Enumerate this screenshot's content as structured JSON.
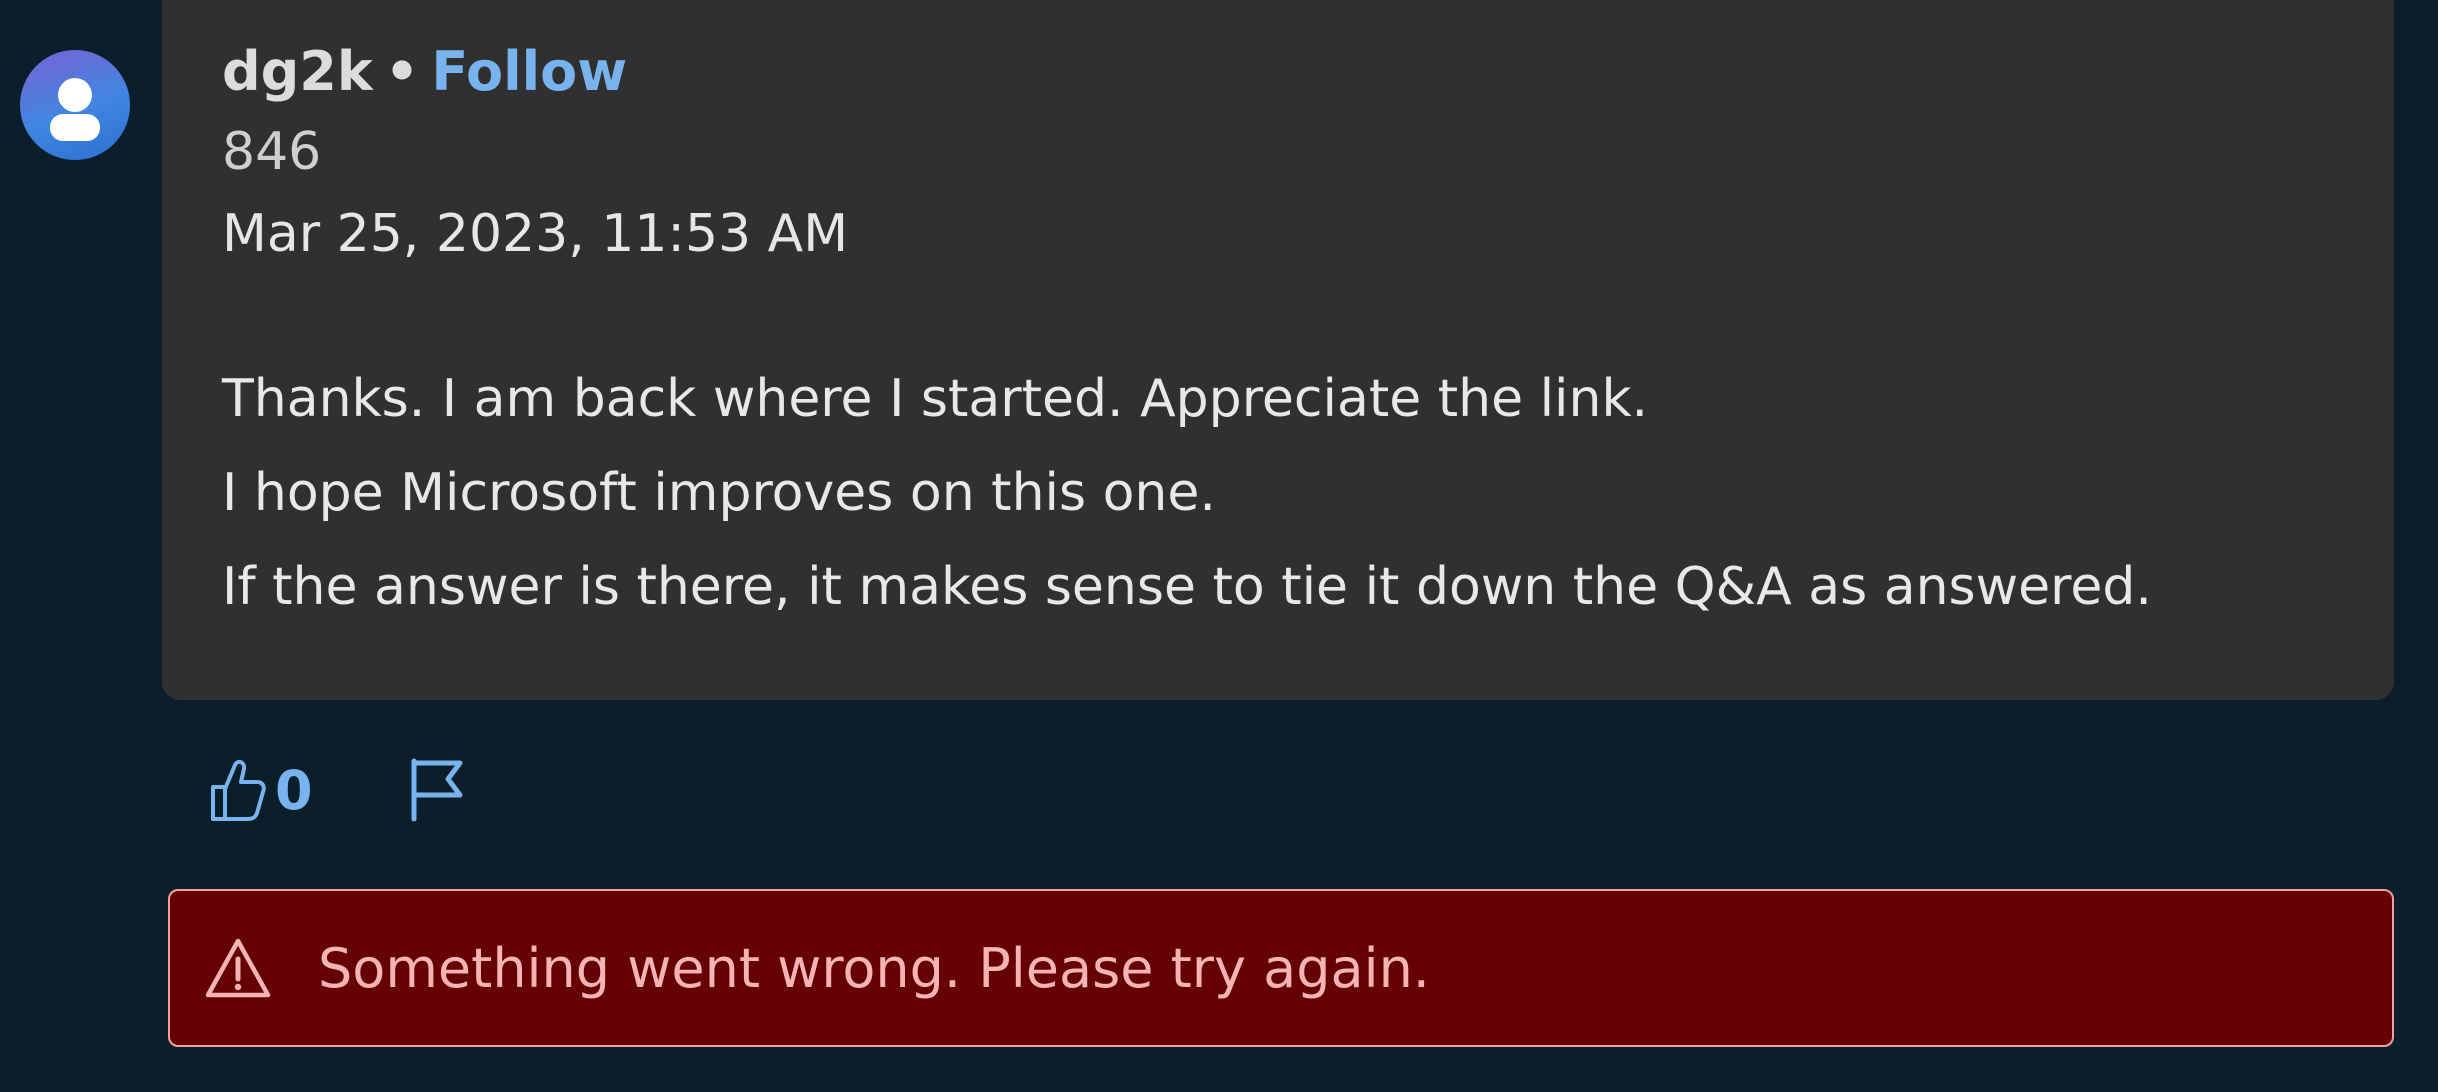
{
  "comment": {
    "author": "dg2k",
    "separator": "•",
    "follow_label": "Follow",
    "reputation": "846",
    "timestamp": "Mar 25, 2023, 11:53 AM",
    "body_lines": [
      "Thanks. I am back where I started. Appreciate the link.",
      "I hope Microsoft improves on this one.",
      "If the answer is there, it makes sense to tie it down the Q&A as answered."
    ]
  },
  "actions": {
    "like_icon": "thumbs-up-icon",
    "like_count": "0",
    "flag_icon": "flag-icon"
  },
  "error": {
    "icon": "warning-icon",
    "message": "Something went wrong. Please try again."
  },
  "colors": {
    "background": "#0b1e2c",
    "card": "#303030",
    "link": "#79b3ee",
    "error_bg": "#650003",
    "error_text": "#f4b4b4"
  }
}
